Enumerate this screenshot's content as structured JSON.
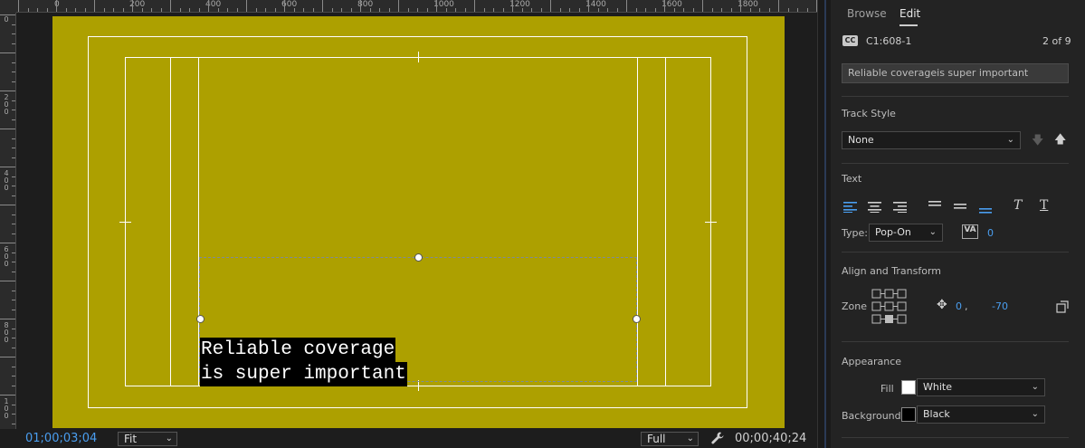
{
  "monitor": {
    "ruler_top_labels": [
      "0",
      "200",
      "400",
      "600",
      "800",
      "1000",
      "1200",
      "1400",
      "1600",
      "1800"
    ],
    "ruler_left_labels": [
      "0",
      "200",
      "400",
      "600",
      "800",
      "100"
    ],
    "caption_line1": "Reliable coverage",
    "caption_line2": "is super important",
    "timecode_current": "01;00;03;04",
    "zoom_select": "Fit",
    "quality_select": "Full",
    "timecode_duration": "00;00;40;24",
    "canvas_color": "#ada000"
  },
  "panel": {
    "tabs": [
      "Browse",
      "Edit"
    ],
    "active_tab": "Edit",
    "caption_id": "C1:608-1",
    "caption_count": "2 of 9",
    "caption_text": "Reliable coverageis super important",
    "track_style_label": "Track Style",
    "track_style_value": "None",
    "text_label": "Text",
    "type_label": "Type:",
    "type_value": "Pop-On",
    "spacing_value": "0",
    "align_transform_label": "Align and Transform",
    "zone_label": "Zone",
    "pos_x": "0",
    "pos_sep": ",",
    "pos_y": "-70",
    "appearance_label": "Appearance",
    "fill_label": "Fill",
    "fill_value": "White",
    "fill_color": "#ffffff",
    "background_label": "Background",
    "background_value": "Black",
    "background_color": "#000000",
    "accent_color": "#4a9ef0"
  }
}
